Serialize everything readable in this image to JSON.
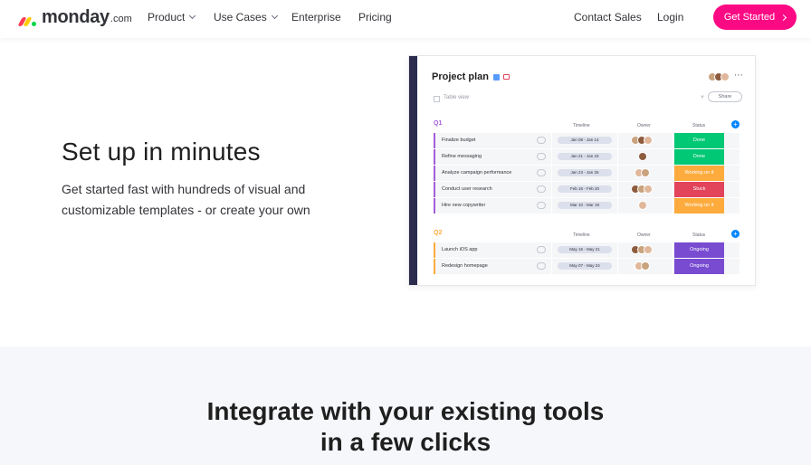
{
  "nav": {
    "logo_word": "monday",
    "logo_suffix": ".com",
    "items": [
      {
        "label": "Product",
        "has_dropdown": true
      },
      {
        "label": "Use Cases",
        "has_dropdown": true
      },
      {
        "label": "Enterprise",
        "has_dropdown": false
      },
      {
        "label": "Pricing",
        "has_dropdown": false
      }
    ],
    "contact": "Contact Sales",
    "login": "Login",
    "cta": "Get Started"
  },
  "hero": {
    "title": "Set up in minutes",
    "subtitle": "Get started fast with hundreds of visual and customizable templates - or create your own"
  },
  "board": {
    "title": "Project plan",
    "view": "Table view",
    "share": "Share",
    "columns": {
      "timeline": "Timeline",
      "owner": "Owner",
      "status": "Status"
    },
    "groups": [
      {
        "label": "Q1",
        "color": "#a25ddc",
        "rows": [
          {
            "name": "Finalize budget",
            "timeline": "Jan 08 - Jan 14",
            "status": "Done",
            "status_color": "#00c875"
          },
          {
            "name": "Refine messaging",
            "timeline": "Jan 21 - Jan 23",
            "status": "Done",
            "status_color": "#00c875"
          },
          {
            "name": "Analyze campaign performance",
            "timeline": "Jan 23 - Jan 26",
            "status": "Working on it",
            "status_color": "#fdab3d"
          },
          {
            "name": "Conduct user research",
            "timeline": "Feb 16 - Feb 20",
            "status": "Stuck",
            "status_color": "#e2445c"
          },
          {
            "name": "Hire new copywriter",
            "timeline": "Mar 10 - Mar 19",
            "status": "Working on it",
            "status_color": "#fdab3d"
          }
        ]
      },
      {
        "label": "Q2",
        "color": "#fdab3d",
        "rows": [
          {
            "name": "Launch iOS app",
            "timeline": "May 16 - May 21",
            "status": "Ongoing",
            "status_color": "#784bd1"
          },
          {
            "name": "Redesign homepage",
            "timeline": "May 07 - May 24",
            "status": "Ongoing",
            "status_color": "#784bd1"
          }
        ]
      }
    ]
  },
  "section2": {
    "title_line1": "Integrate with your existing tools",
    "title_line2": "in a few clicks"
  }
}
